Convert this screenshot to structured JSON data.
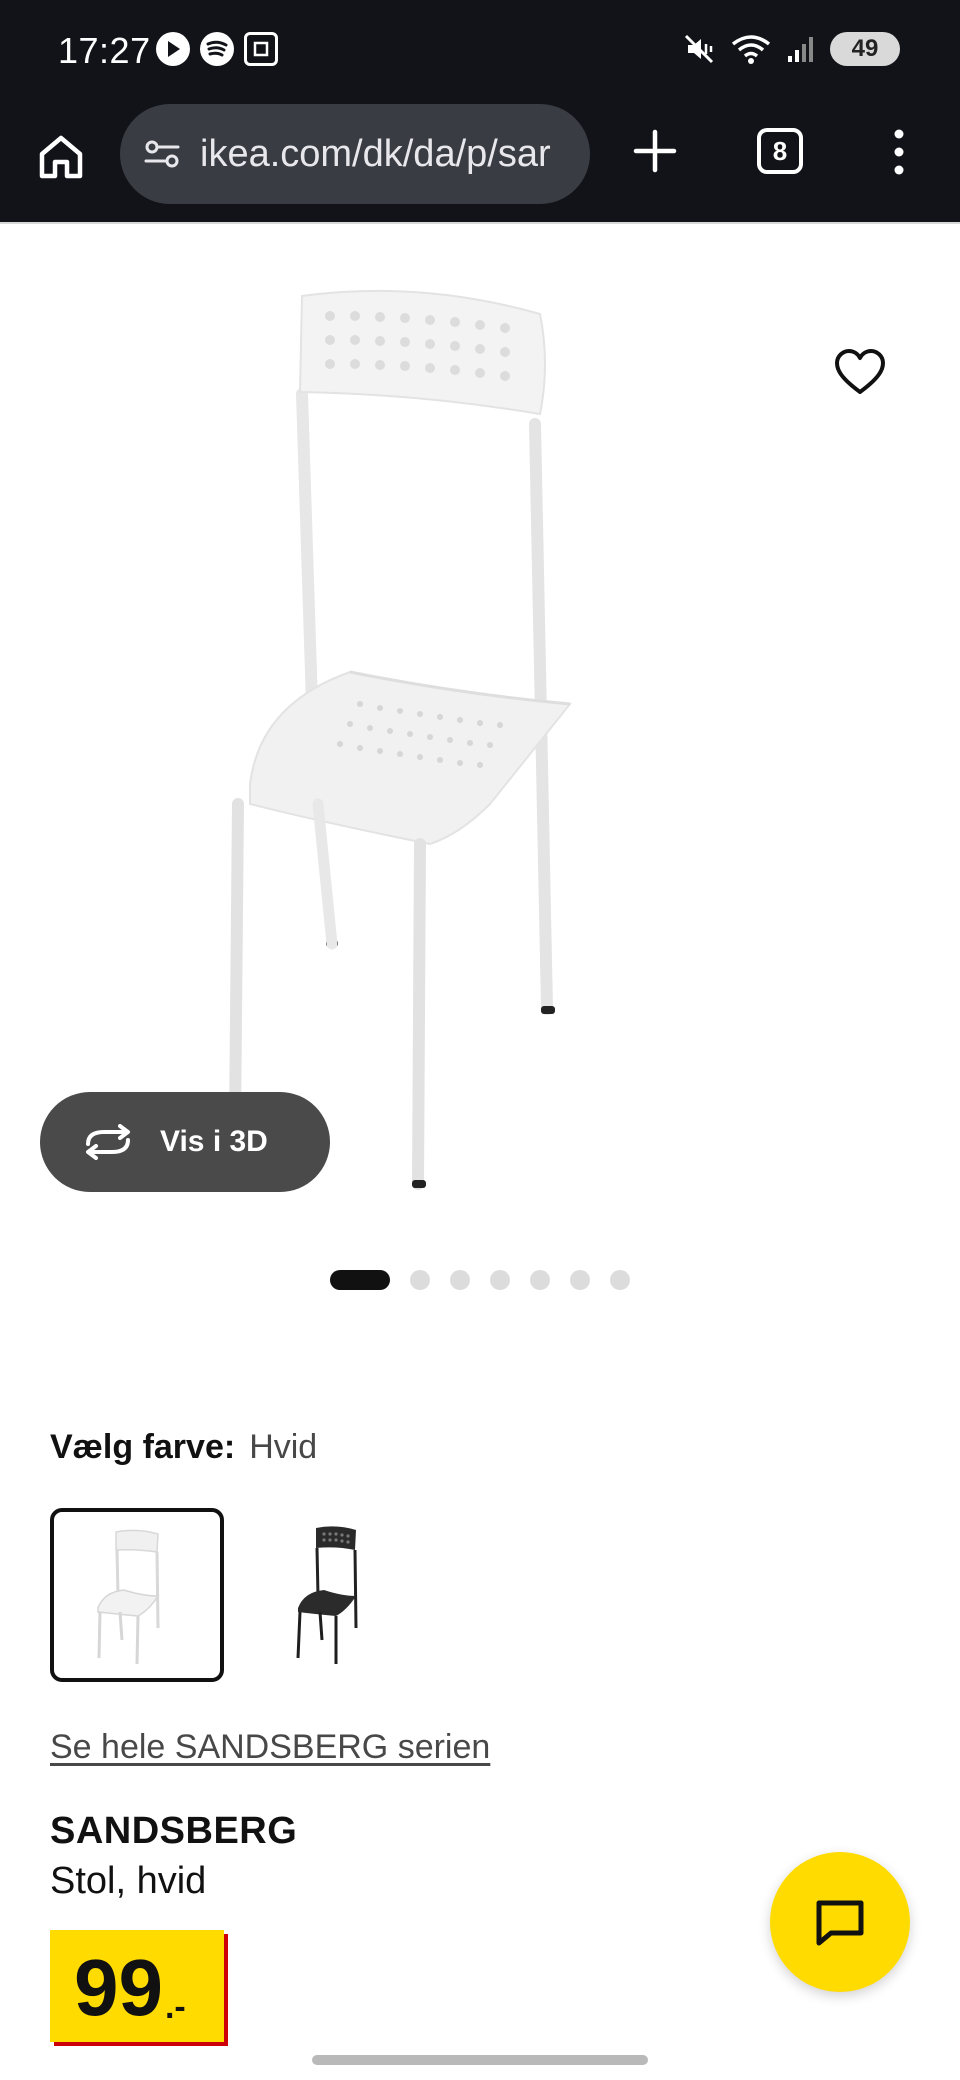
{
  "status_bar": {
    "time": "17:27",
    "battery": "49",
    "icons_left": [
      "play-store-icon",
      "spotify-icon",
      "screenshot-icon"
    ],
    "icons_right": [
      "mute-vibrate-icon",
      "wifi-icon",
      "signal-icon",
      "battery-icon"
    ]
  },
  "browser": {
    "url": "ikea.com/dk/da/p/sar",
    "tab_count": "8"
  },
  "product_gallery": {
    "vis_3d_label": "Vis i 3D",
    "image_count": 7,
    "active_index": 0
  },
  "color_select": {
    "label": "Vælg farve:",
    "value": "Hvid",
    "options": [
      {
        "name": "white-chair",
        "selected": true
      },
      {
        "name": "black-chair",
        "selected": false
      }
    ]
  },
  "series_link": "Se hele SANDSBERG serien",
  "product": {
    "name": "SANDSBERG",
    "description": "Stol, hvid",
    "price_integer": "99",
    "price_decimal": ".-"
  },
  "colors": {
    "ikea_yellow": "#ffdb00",
    "price_shadow_red": "#cc0008",
    "chrome_bg": "#121318"
  }
}
